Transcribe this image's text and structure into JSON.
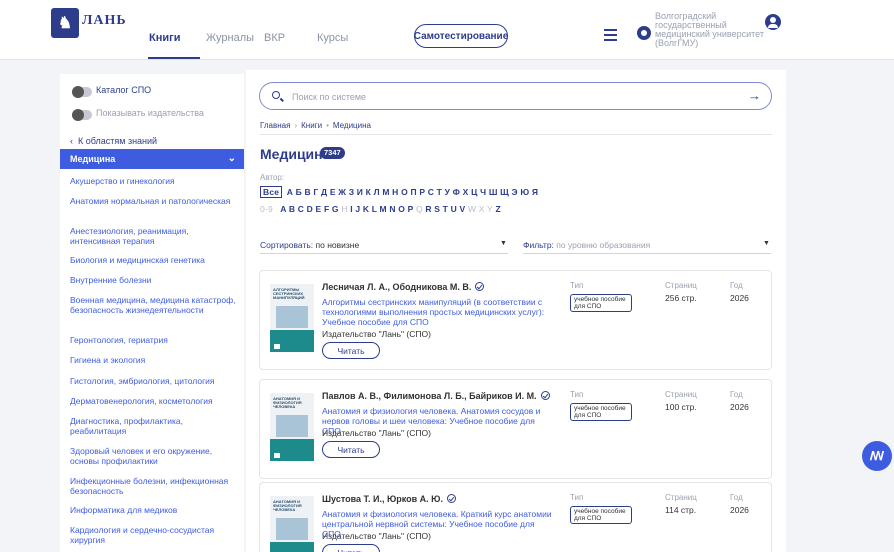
{
  "header": {
    "logo_text": "ЛАНЬ",
    "nav": [
      "Книги",
      "Журналы",
      "ВКР",
      "Курсы"
    ],
    "selftest": "Самотестирование",
    "org": "Волгоградский государственный медицинский университет (ВолгГМУ)"
  },
  "sidebar": {
    "toggle_spo": "Каталог СПО",
    "toggle_publishers": "Показывать издательства",
    "back": "К областям знаний",
    "active_category": "Медицина",
    "categories": [
      "Акушерство и гинекология",
      "Анатомия нормальная и патологическая",
      "Анестезиология, реанимация, интенсивная терапия",
      "Биология и медицинская генетика",
      "Внутренние болезни",
      "Военная медицина, медицина катастроф, безопасность жизнедеятельности",
      "Геронтология, гериатрия",
      "Гигиена и экология",
      "Гистология, эмбриология, цитология",
      "Дерматовенерология, косметология",
      "Диагностика, профилактика, реабилитация",
      "Здоровый человек и его окружение, основы профилактики",
      "Инфекционные болезни, инфекционная безопасность",
      "Информатика для медиков",
      "Кардиология и сердечно-сосудистая хирургия"
    ]
  },
  "main": {
    "search_placeholder": "Поиск по системе",
    "breadcrumbs": [
      "Главная",
      "Книги",
      "Медицина"
    ],
    "title": "Медицина",
    "count": "7347",
    "author_label": "Автор:",
    "alpha_all": "Все",
    "alpha_ru": "А Б В Г Д Е Ж З И К Л М Н О П Р С Т У Ф Х Ц Ч Ш Щ Э Ю Я",
    "alpha_digits": "0-9",
    "alpha_en_a": "A B C D E F G",
    "alpha_en_h": "H",
    "alpha_en_b": "I J K L M N O P",
    "alpha_en_q": "Q",
    "alpha_en_c": "R S T U V",
    "alpha_en_wxy": "W X Y",
    "alpha_en_z": "Z",
    "sort_label": "Сортировать:",
    "sort_value": "по новизне",
    "filter_label": "Фильтр:",
    "filter_value": "по уровню образования",
    "meta_labels": {
      "type": "Тип",
      "pages": "Страниц",
      "year": "Год"
    },
    "read_label": "Читать",
    "books": [
      {
        "authors": "Лесничая Л. А., Ободникова М. В.",
        "title": "Алгоритмы сестринских манипуляций (в соответствии с технологиями выполнения простых медицинских услуг): Учебное пособие для СПО",
        "publisher": "Издательство \"Лань\" (СПО)",
        "type": "учебное пособие для СПО",
        "pages": "256 стр.",
        "year": "2026",
        "cover_text": "АЛГОРИТМЫ СЕСТРИНСКИХ МАНИПУЛЯЦИЙ"
      },
      {
        "authors": "Павлов А. В., Филимонова Л. Б., Байриков И. М.",
        "title": "Анатомия и физиология человека. Анатомия сосудов и нервов головы и шеи человека: Учебное пособие для СПО",
        "publisher": "Издательство \"Лань\" (СПО)",
        "type": "учебное пособие для СПО",
        "pages": "100 стр.",
        "year": "2026",
        "cover_text": "АНАТОМИЯ И ФИЗИОЛОГИЯ ЧЕЛОВЕКА"
      },
      {
        "authors": "Шустова Т. И., Юрков А. Ю.",
        "title": "Анатомия и физиология человека. Краткий курс анатомии центральной нервной системы: Учебное пособие для СПО",
        "publisher": "Издательство \"Лань\" (СПО)",
        "type": "учебное пособие для СПО",
        "pages": "114 стр.",
        "year": "2026",
        "cover_text": "АНАТОМИЯ И ФИЗИОЛОГИЯ ЧЕЛОВЕКА"
      }
    ]
  },
  "float_button": "ЛАНЬ",
  "colors": {
    "brand": "#2d3d8c",
    "accent": "#3d5ce0",
    "cover_teal": "#1d8a8c"
  }
}
